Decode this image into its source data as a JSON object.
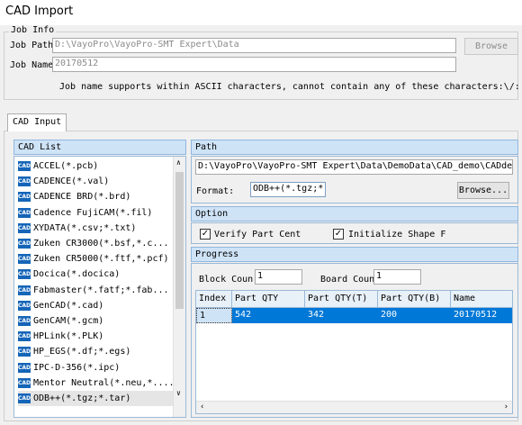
{
  "window": {
    "title": "CAD Import"
  },
  "job_info": {
    "group_label": "Job Info",
    "job_path_label": "Job Path",
    "job_path_value": "D:\\VayoPro\\VayoPro-SMT Expert\\Data",
    "browse_label": "Browse",
    "job_name_label": "Job Name",
    "job_name_value": "20170512",
    "hint": "Job name supports within ASCII characters, cannot contain any of these characters:\\/:"
  },
  "tabs": [
    {
      "label": "CAD Input"
    }
  ],
  "cad_list": {
    "header": "CAD List",
    "badge": "CAD",
    "items": [
      {
        "label": "ACCEL(*.pcb)"
      },
      {
        "label": "CADENCE(*.val)"
      },
      {
        "label": "CADENCE BRD(*.brd)"
      },
      {
        "label": "Cadence FujiCAM(*.fil)"
      },
      {
        "label": "XYDATA(*.csv;*.txt)"
      },
      {
        "label": "Zuken CR3000(*.bsf,*.c..."
      },
      {
        "label": "Zuken CR5000(*.ftf,*.pcf)"
      },
      {
        "label": "Docica(*.docica)"
      },
      {
        "label": "Fabmaster(*.fatf;*.fab..."
      },
      {
        "label": "GenCAD(*.cad)"
      },
      {
        "label": "GenCAM(*.gcm)"
      },
      {
        "label": "HPLink(*.PLK)"
      },
      {
        "label": "HP_EGS(*.df;*.egs)"
      },
      {
        "label": "IPC-D-356(*.ipc)"
      },
      {
        "label": "Mentor Neutral(*.neu,*...."
      },
      {
        "label": "ODB++(*.tgz;*.tar)"
      }
    ],
    "selected_index": 15
  },
  "path_section": {
    "header": "Path",
    "path_value": "D:\\VayoPro\\VayoPro-SMT Expert\\Data\\DemoData\\CAD_demo\\CADde",
    "format_label": "Format:",
    "format_value": "ODB++(*.tgz;*.tar)",
    "browse_label": "Browse..."
  },
  "option_section": {
    "header": "Option",
    "verify_label": "Verify Part Cent",
    "verify_checked": true,
    "init_label": "Initialize Shape F",
    "init_checked": true
  },
  "progress_section": {
    "header": "Progress",
    "block_count_label": "Block Coun",
    "block_count_value": "1",
    "board_count_label": "Board Coun",
    "board_count_value": "1",
    "table": {
      "columns": [
        "Index",
        "Part QTY",
        "Part QTY(T)",
        "Part QTY(B)",
        "Name"
      ],
      "rows": [
        {
          "index": "1",
          "part_qty": "542",
          "part_qty_t": "342",
          "part_qty_b": "200",
          "name": "20170512"
        }
      ]
    }
  },
  "colors": {
    "selection": "#0078d7",
    "header_bg": "#cfe3f7",
    "badge": "#1565b8"
  }
}
